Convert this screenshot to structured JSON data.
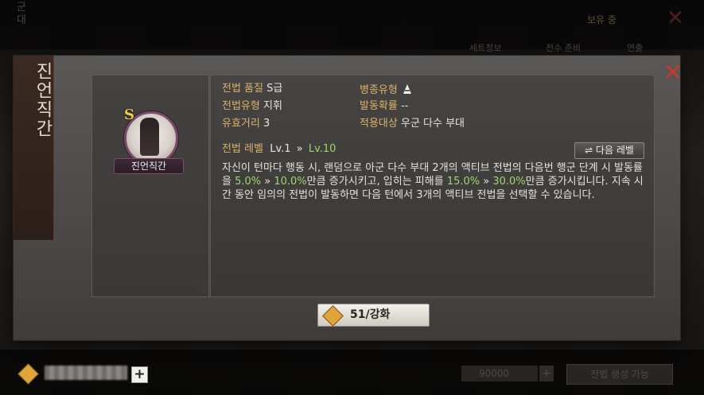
{
  "background": {
    "vertical_text": "군대",
    "top_badge": "보유 중",
    "tabs": [
      "세트정보",
      "전수 준비",
      "연출"
    ],
    "gold_value": "90000",
    "action_button": "전법 생성 가능"
  },
  "dialog": {
    "banner_title": "진언직간",
    "close_label": "✕",
    "skill": {
      "grade": "S",
      "portrait_name": "진언직간"
    },
    "info": {
      "quality_label": "전법 품질",
      "quality_value": "S급",
      "type_label": "전법유형",
      "type_value": "지휘",
      "range_label": "유효거리",
      "range_value": "3",
      "troop_label": "병종유형",
      "troop_icon": "bow-icon",
      "rate_label": "발동확률",
      "rate_value": "--",
      "target_label": "적용대상",
      "target_value": "우군 다수 부대"
    },
    "level": {
      "label": "전법 레벨",
      "current": "Lv.1",
      "arrow": "»",
      "max": "Lv.10",
      "next_button": "⇌ 다음 레벨"
    },
    "description": {
      "part1": "자신이 턴마다 행동 시, 랜덤으로 아군 다수 부대 2개의 액티브 전법의 다음번 행군 단계 시 발동률을 ",
      "v1": "5.0%",
      "arrow1": " » ",
      "v2": "10.0%",
      "part2": "만큼 증가시키고, 입히는 피해를 ",
      "v3": "15.0%",
      "arrow2": " » ",
      "v4": "30.0%",
      "part3": "만큼 증가시킵니다. 지속 시간 동안 임의의 전법이 발동하면 다음 턴에서 3개의 액티브 전법을 선택할 수 있습니다."
    },
    "enhance_button": "51/강화"
  },
  "footer": {
    "currency_icon": "token-icon",
    "plus_label": "+"
  },
  "colors": {
    "label": "#d9b26a",
    "highlight": "#9bd86b",
    "close": "#c43a2f"
  }
}
